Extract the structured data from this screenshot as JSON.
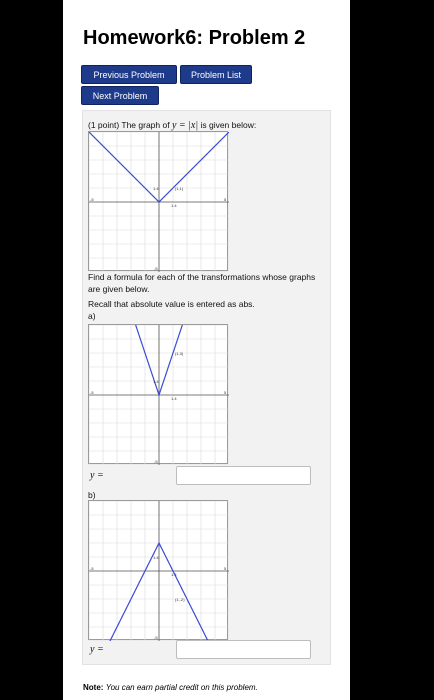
{
  "title": "Homework6: Problem 2",
  "buttons": {
    "previous": "Previous Problem",
    "list": "Problem List",
    "next": "Next Problem"
  },
  "problem": {
    "points": "(1 point) The graph of",
    "expr": "y = |x|",
    "given": "is given below:",
    "instruction": "Find a formula for each of the transformations whose graphs are given below.",
    "abs_note": "Recall that absolute value is entered as abs.",
    "part_a": "a)",
    "part_b": "b)",
    "answer_label": "y ="
  },
  "graphs": {
    "main": {
      "point_label": "(1,1)",
      "y_tick": "1.4",
      "x_tick": "1.4",
      "x_min_label": "-5",
      "x_max_label": "5",
      "y_min_label": "-5"
    },
    "a": {
      "point_label": "(1,3)",
      "y_tick": "1.4",
      "x_tick": "1.4",
      "x_min_label": "-5",
      "x_max_label": "5",
      "y_min_label": "-5"
    },
    "b": {
      "point_label": "(1,-2)",
      "y_tick": "1.4",
      "x_tick": "1.4",
      "x_min_label": "-5",
      "x_max_label": "5",
      "y_min_label": "-5"
    }
  },
  "answers": {
    "a": "",
    "b": ""
  },
  "note": {
    "label": "Note:",
    "text": "You can earn partial credit on this problem."
  },
  "colors": {
    "button": "#1e3a8a",
    "curve": "#3b4bd8",
    "panel": "#f2f2f2"
  }
}
